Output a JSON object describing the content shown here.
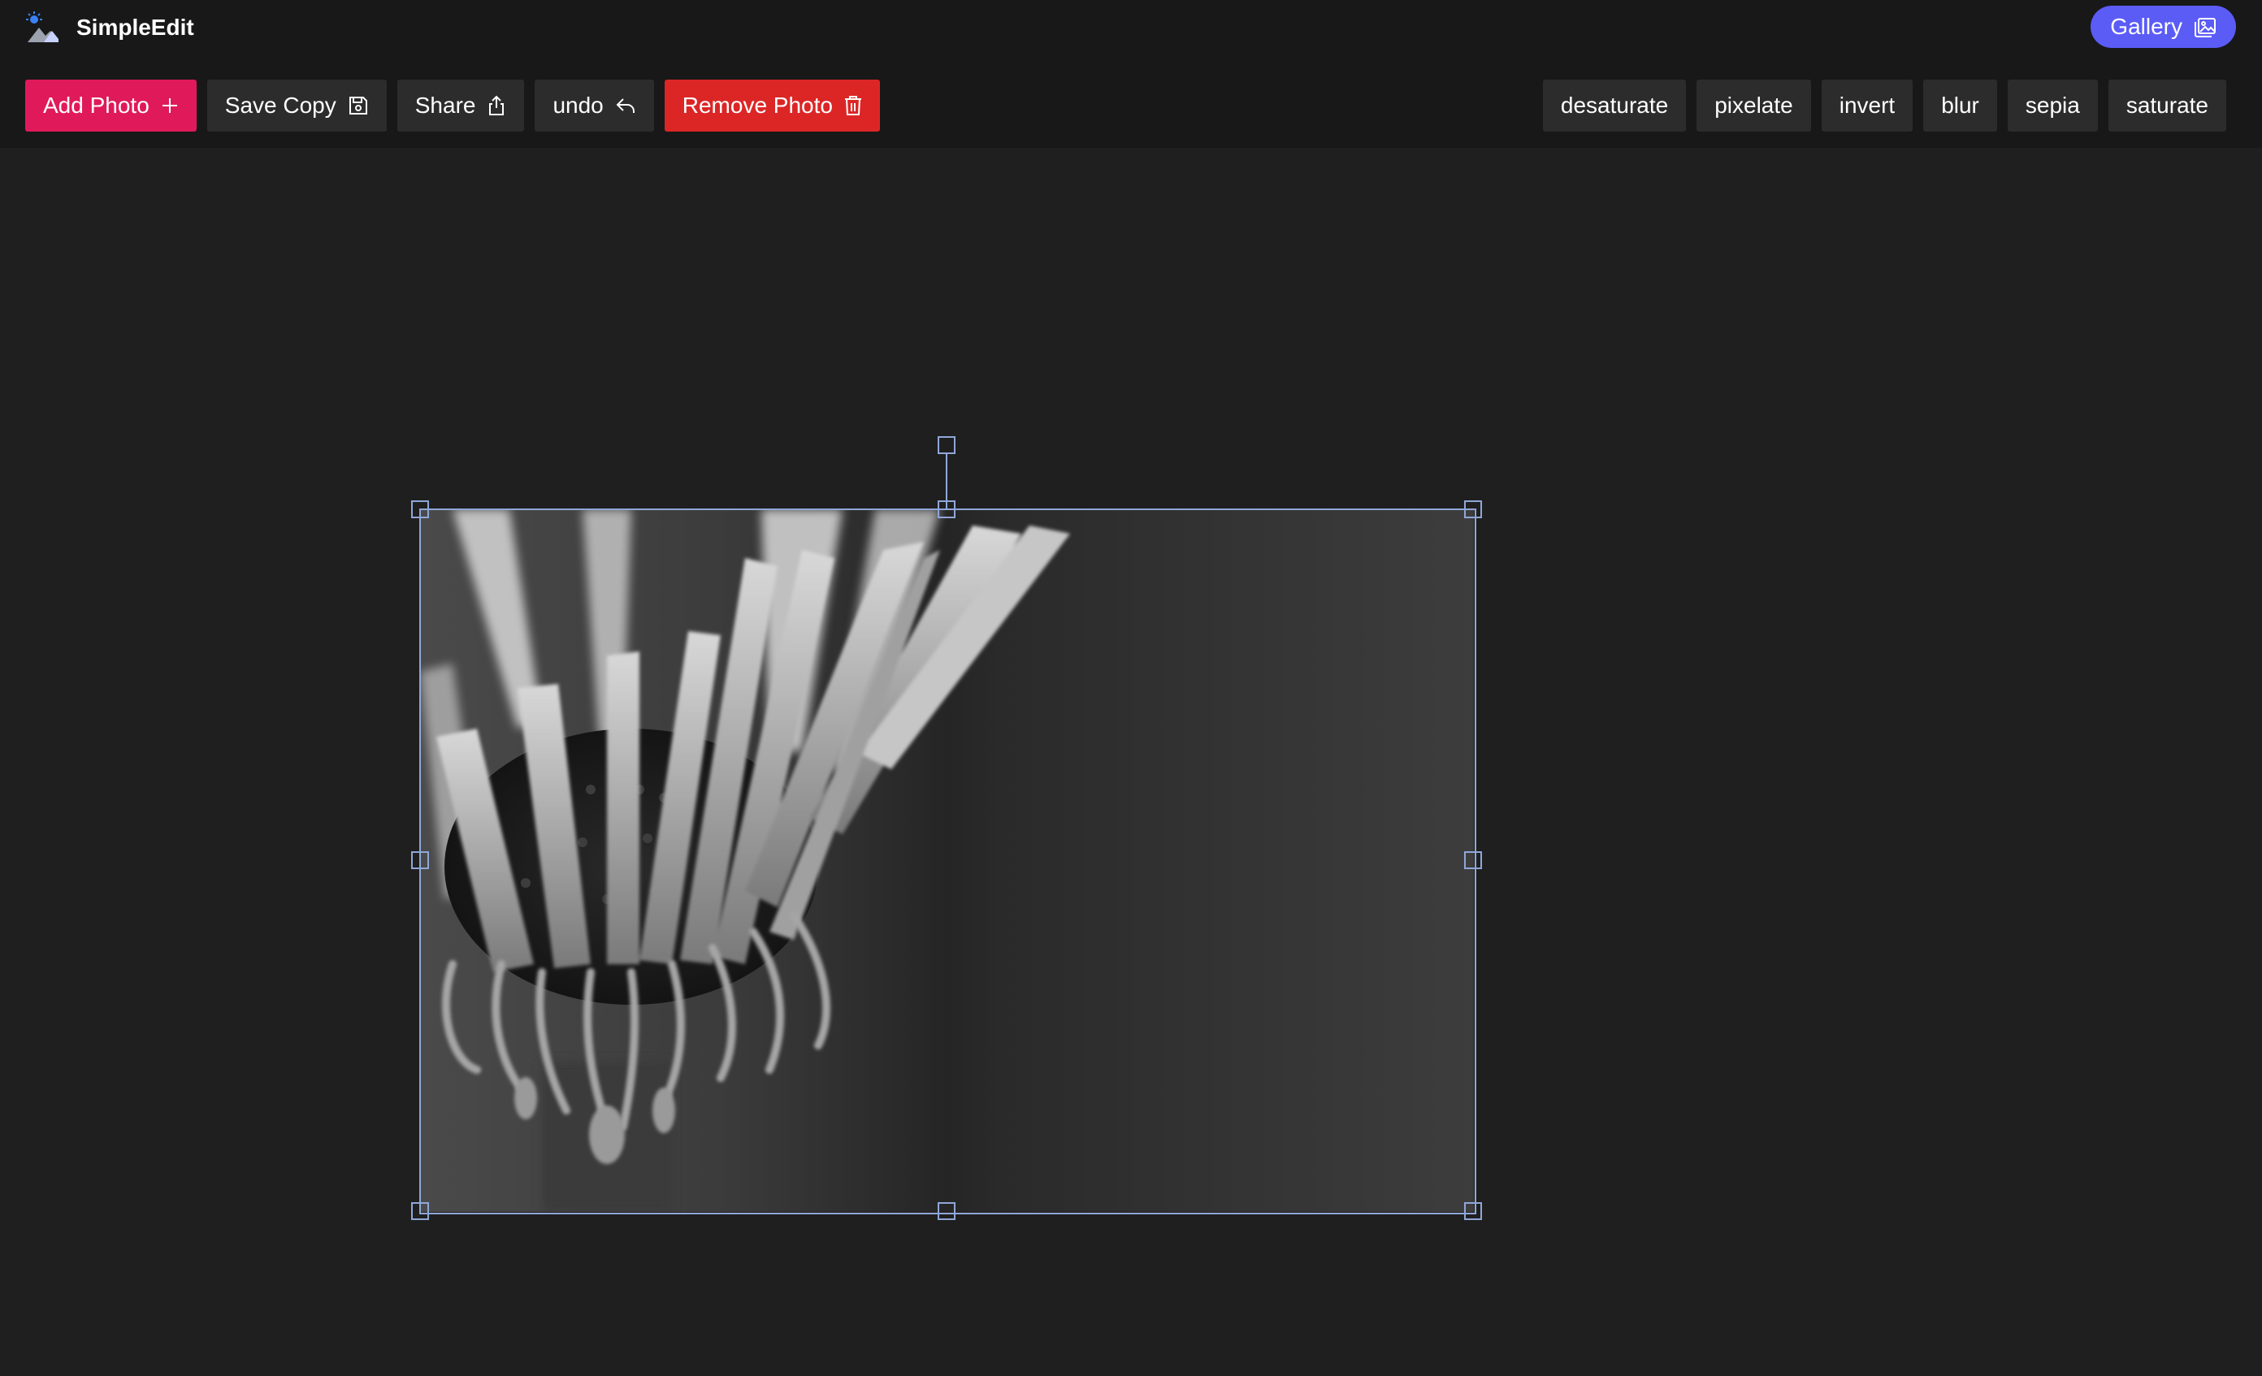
{
  "app": {
    "title": "SimpleEdit",
    "gallery_label": "Gallery"
  },
  "toolbar": {
    "add_photo": "Add Photo",
    "save_copy": "Save Copy",
    "share": "Share",
    "undo": "undo",
    "remove_photo": "Remove Photo"
  },
  "filters": [
    "desaturate",
    "pixelate",
    "invert",
    "blur",
    "sepia",
    "saturate"
  ],
  "colors": {
    "background": "#1f1f1f",
    "topbar": "#181818",
    "accent_gallery": "#5b5cf6",
    "add_photo": "#e0195b",
    "remove_photo": "#dc2626",
    "selection": "#8fa7d9"
  },
  "icons": {
    "logo": "logo-icon",
    "gallery": "gallery-icon",
    "add": "plus-icon",
    "save": "save-icon",
    "share": "share-icon",
    "undo": "undo-icon",
    "remove": "trash-icon"
  },
  "canvas": {
    "image_description": "grayscale close-up photo of a flower",
    "filter_applied": "desaturate"
  }
}
